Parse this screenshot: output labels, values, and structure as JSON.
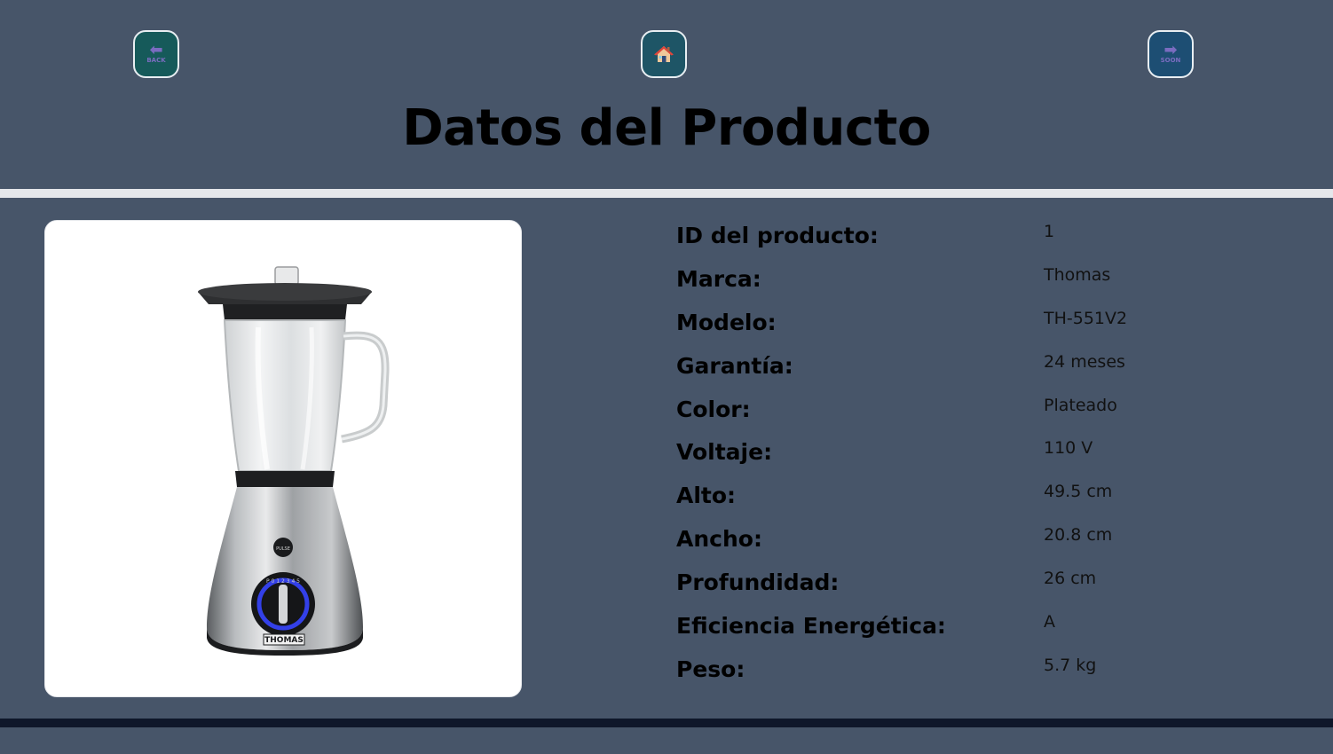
{
  "nav": {
    "back_caption": "BACK",
    "next_caption": "SOON"
  },
  "title": "Datos del Producto",
  "product": {
    "image_alt": "Licuadora Thomas",
    "brand_logo_text": "THOMAS",
    "specs": [
      {
        "label": "ID del producto:",
        "value": "1"
      },
      {
        "label": "Marca:",
        "value": "Thomas"
      },
      {
        "label": "Modelo:",
        "value": "TH-551V2"
      },
      {
        "label": "Garantía:",
        "value": "24 meses"
      },
      {
        "label": "Color:",
        "value": "Plateado"
      },
      {
        "label": "Voltaje:",
        "value": "110 V"
      },
      {
        "label": "Alto:",
        "value": "49.5 cm"
      },
      {
        "label": "Ancho:",
        "value": "20.8 cm"
      },
      {
        "label": "Profundidad:",
        "value": "26 cm"
      },
      {
        "label": "Eficiencia Energética:",
        "value": "A"
      },
      {
        "label": "Peso:",
        "value": "5.7 kg"
      }
    ]
  },
  "colors": {
    "background": "#475569",
    "divider_top": "#e5e7eb",
    "divider_bottom": "#0f172a",
    "back_button": "#165a5a",
    "home_button": "#1e5566",
    "next_button": "#1d4e73"
  },
  "icons": {
    "back": "arrow-left-icon",
    "home": "house-icon",
    "next": "arrow-right-icon"
  }
}
